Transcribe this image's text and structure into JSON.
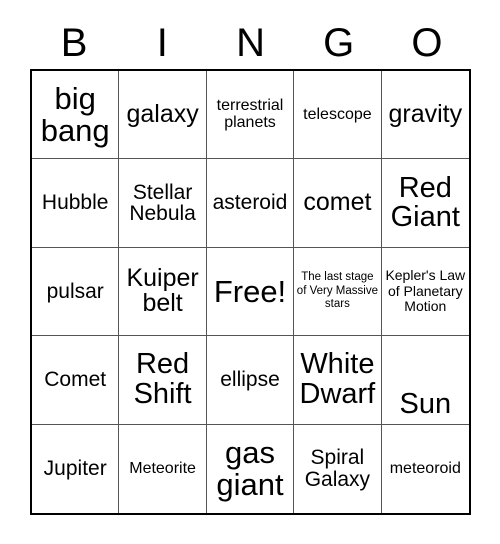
{
  "card": {
    "title": "BINGO",
    "header_letters": [
      "B",
      "I",
      "N",
      "G",
      "O"
    ],
    "free_space_label": "Free!",
    "colors": {
      "background": "#ffffff",
      "text": "#000000",
      "outer_border": "#000000",
      "inner_border": "#555555"
    },
    "rows": [
      [
        {
          "text": "big bang",
          "size": "s-xxl"
        },
        {
          "text": "galaxy",
          "size": "s-lg"
        },
        {
          "text": "terrestrial planets",
          "size": "s-sm"
        },
        {
          "text": "telescope",
          "size": "s-sm"
        },
        {
          "text": "gravity",
          "size": "s-lg"
        }
      ],
      [
        {
          "text": "Hubble",
          "size": "s-md"
        },
        {
          "text": "Stellar Nebula",
          "size": "s-md"
        },
        {
          "text": "asteroid",
          "size": "s-md"
        },
        {
          "text": "comet",
          "size": "s-lg"
        },
        {
          "text": "Red Giant",
          "size": "s-xl"
        }
      ],
      [
        {
          "text": "pulsar",
          "size": "s-md"
        },
        {
          "text": "Kuiper belt",
          "size": "s-lg"
        },
        {
          "text": "Free!",
          "size": "s-xxl"
        },
        {
          "text": "The last stage of Very Massive stars",
          "size": "s-xxs"
        },
        {
          "text": "Kepler's Law of Planetary Motion",
          "size": "s-xs"
        }
      ],
      [
        {
          "text": "Comet",
          "size": "s-md"
        },
        {
          "text": "Red Shift",
          "size": "s-xl"
        },
        {
          "text": "ellipse",
          "size": "s-md"
        },
        {
          "text": "White Dwarf",
          "size": "s-xl"
        },
        {
          "text": "Sun",
          "size": "s-xl"
        }
      ],
      [
        {
          "text": "Jupiter",
          "size": "s-md"
        },
        {
          "text": "Meteorite",
          "size": "s-sm"
        },
        {
          "text": "gas giant",
          "size": "s-xxl"
        },
        {
          "text": "Spiral Galaxy",
          "size": "s-md"
        },
        {
          "text": "meteoroid",
          "size": "s-sm"
        }
      ]
    ]
  }
}
